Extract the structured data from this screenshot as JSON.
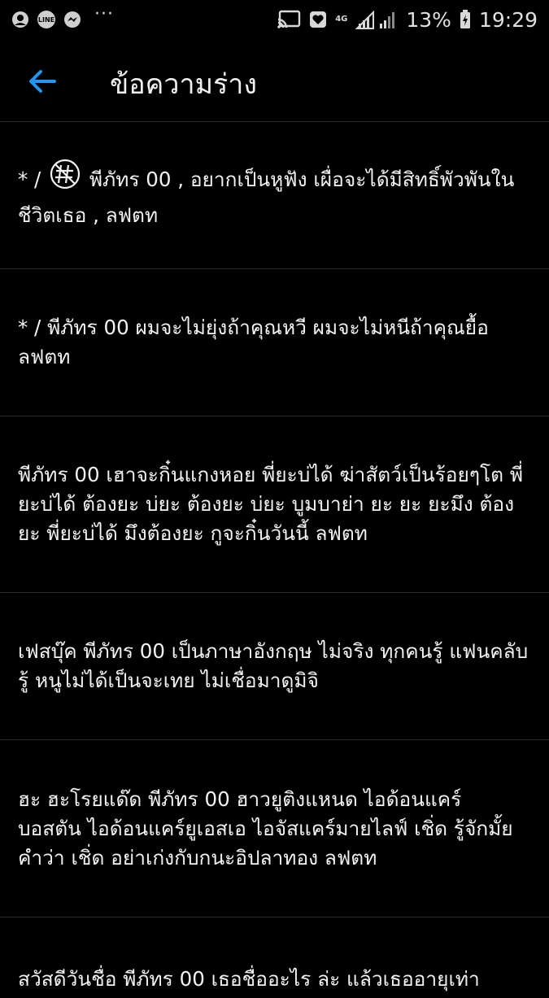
{
  "status_bar": {
    "apps": [
      "LINE"
    ],
    "network": "4G",
    "battery": "13%",
    "time": "19:29"
  },
  "app_bar": {
    "title": "ข้อความร่าง",
    "back_icon": "arrow-left-icon"
  },
  "colors": {
    "background": "#000000",
    "accent": "#2196F3",
    "text": "#F2F2F2",
    "divider": "#2A2A2A"
  },
  "drafts": [
    {
      "prefix": "* /",
      "text": "พีภัทร 00 , อยากเป็นหูฟัง เผื่อจะได้มีสิทธิ์พัวพันในชีวิตเธอ , ลฟตท"
    },
    {
      "text": "* / พีภัทร 00 ผมจะไม่ยุ่งถ้าคุณหวี ผมจะไม่หนีถ้าคุณยื้อ ลฟตท"
    },
    {
      "text": "พีภัทร 00 เฮาจะกิ๋นแกงหอย พี่ยะบ่ได้ ฆ่าสัตว์เป็นร้อยๆโต พี่ยะบ่ได้ ต้องยะ บ่ยะ ต้องยะ บ่ยะ บูมบาย่า ยะ ยะ ยะมึง ต้องยะ พี่ยะบ่ได้ มึงต้องยะ กูจะกิ๋นวันนี้ ลฟตท"
    },
    {
      "text": "เฟสบุ๊ค พีภัทร 00 เป็นภาษาอังกฤษ ไม่จริง ทุกคนรู้ แฟนคลับรู้ หนูไม่ได้เป็นจะเทย ไม่เชื่อมาดูมิจิ"
    },
    {
      "text": "ฮะ ฮะโรยแด๊ด พีภัทร 00 ฮาวยูติงแหนด ไอด้อนแคร์ บอสตัน ไอด้อนแคร์ยูเอสเอ ไอจัสแคร์มายไลฟ์ เชิ่ด รู้จักมั้ยคำว่า เชิ่ด อย่าเก่งกับกนะอิปลาทอง ลฟตท"
    },
    {
      "text": "สวัสดีวันชื่อ พีภัทร 00 เธอชื่ออะไร ล่ะ แล้วเธออายุเท่า"
    }
  ]
}
